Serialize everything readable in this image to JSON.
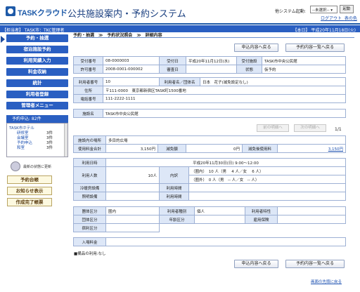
{
  "header": {
    "logo_text": "TASKクラウド",
    "app_title": "公共施設案内・予約システム",
    "system_label": "他システム起動:",
    "system_select_value": "--未選択--",
    "launch_label": "起動",
    "logout_label": "ログアウト",
    "help_label": "表の色"
  },
  "status_bar": {
    "left": "【担当者】 TASK市：TKC管理者",
    "right": "【本日】 平成20年11月18日(火)"
  },
  "sidebar": {
    "items": [
      {
        "label": "予約・抽選"
      },
      {
        "label": "宿泊施設予約"
      },
      {
        "label": "利用実績入力"
      },
      {
        "label": "料金収納"
      },
      {
        "label": "統計"
      },
      {
        "label": "利用者登録"
      },
      {
        "label": "管理者メニュー"
      }
    ],
    "reservation_header": "予約申込: 82件",
    "facility_name": "TASK市ホテル",
    "reservation_rows": [
      {
        "label": "研修室",
        "count": "3件"
      },
      {
        "label": "会議室",
        "count": "3件"
      },
      {
        "label": "予約申込",
        "count": "3件"
      },
      {
        "label": "和室",
        "count": "3件"
      }
    ],
    "refresh_label": "最新の状態に更新",
    "sub_buttons": [
      {
        "label": "予約台帳"
      },
      {
        "label": "お知らせ表示"
      },
      {
        "label": "作成完了帳票"
      }
    ]
  },
  "breadcrumb": [
    "予約・抽選",
    "≫",
    "予約状況照会",
    "≫",
    "詳細内容"
  ],
  "buttons": {
    "apply_back": "申込内容へ戻る",
    "list_back": "予約内容一覧へ戻る",
    "prev": "前の明細へ",
    "next": "次の明細へ",
    "page": "1/1"
  },
  "details": {
    "receipt_no_label": "受付番号",
    "receipt_no": "08-0000003",
    "receipt_date_label": "受付日",
    "receipt_date": "平成20年11月12日(水)",
    "receipt_facility_label": "受付施設",
    "receipt_facility": "TASK市中央公民館",
    "permit_no_label": "許可番号",
    "permit_no": "2008-0001-000002",
    "review_date_label": "審査日",
    "review_date": "",
    "status_label": "状態",
    "status": "仮予約",
    "user_no_label": "利用者番号",
    "user_no": "10",
    "user_name_label": "利用者名／団体名",
    "user_name": "日本　花子(減免設定なし)",
    "address_label": "住所",
    "address": "〒111-0000　東京都新宿区TASK町1500番地",
    "phone_label": "電話番号",
    "phone": "111-2222-1111",
    "facility_label": "施設名",
    "facility": "TASK市中央公民館",
    "place_label": "施設内の場所",
    "place": "多目的広場",
    "fee_total_label": "使用料金合計",
    "fee_total": "3,150円",
    "reduction_label": "減免額",
    "reduction": "0円",
    "after_reduction_label": "減免後使用料",
    "after_reduction": "3,150円",
    "use_date_label": "利用日時",
    "use_date": "平成20年11月30日(日)  9:00～12:00",
    "people_label": "利用人数",
    "people": "10人",
    "breakdown_label": "内訳",
    "breakdown_in": "（圏内）　10 人（男　 4 人／女　 6 人）",
    "breakdown_out": "（圏外）　0 人（男　-- 人／女　-- 人）",
    "aircon_label": "冷暖房設備",
    "aircon_time_label": "利用時間",
    "lighting_label": "照明設備",
    "lighting_time_label": "利用時間",
    "group_class_label": "團体区分",
    "group_class": "圏内",
    "user_type_label": "利用者種別",
    "user_type": "個人",
    "user_trait_label": "利用者特性",
    "age_class_label": "団体区分",
    "age_label": "年齢区分",
    "employ_label": "雇用保険",
    "lodging_label": "宿利区分",
    "entry_fee_label": "入場料金"
  },
  "note": "■備品の利用:なし",
  "bottom_link": "画面の先頭に戻る"
}
